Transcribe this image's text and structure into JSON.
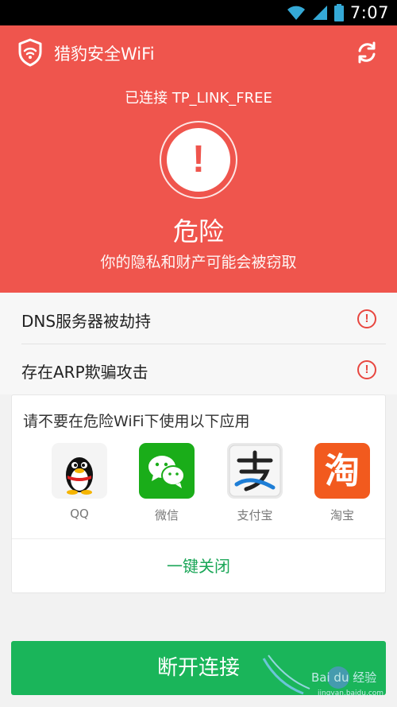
{
  "status_bar": {
    "time": "7:07"
  },
  "header": {
    "app_title": "猎豹安全WiFi",
    "connected_text": "已连接 TP_LINK_FREE",
    "alert_symbol": "!",
    "danger_title": "危险",
    "danger_subtitle": "你的隐私和财产可能会被窃取"
  },
  "issues": [
    {
      "label": "DNS服务器被劫持",
      "icon": "!"
    },
    {
      "label": "存在ARP欺骗攻击",
      "icon": "!"
    }
  ],
  "app_card": {
    "title": "请不要在危险WiFi下使用以下应用",
    "apps": [
      {
        "name": "QQ",
        "icon": "qq-penguin-icon"
      },
      {
        "name": "微信",
        "icon": "wechat-icon"
      },
      {
        "name": "支付宝",
        "icon": "alipay-icon"
      },
      {
        "name": "淘宝",
        "icon": "taobao-icon",
        "glyph": "淘"
      }
    ],
    "close_all_label": "一键关闭"
  },
  "disconnect_label": "断开连接",
  "watermark": {
    "brand": "Bai du 经验",
    "url": "jingyan.baidu.com"
  },
  "colors": {
    "danger_red": "#ef554d",
    "accent_green": "#1ab55a",
    "warn_red": "#e8463f"
  }
}
